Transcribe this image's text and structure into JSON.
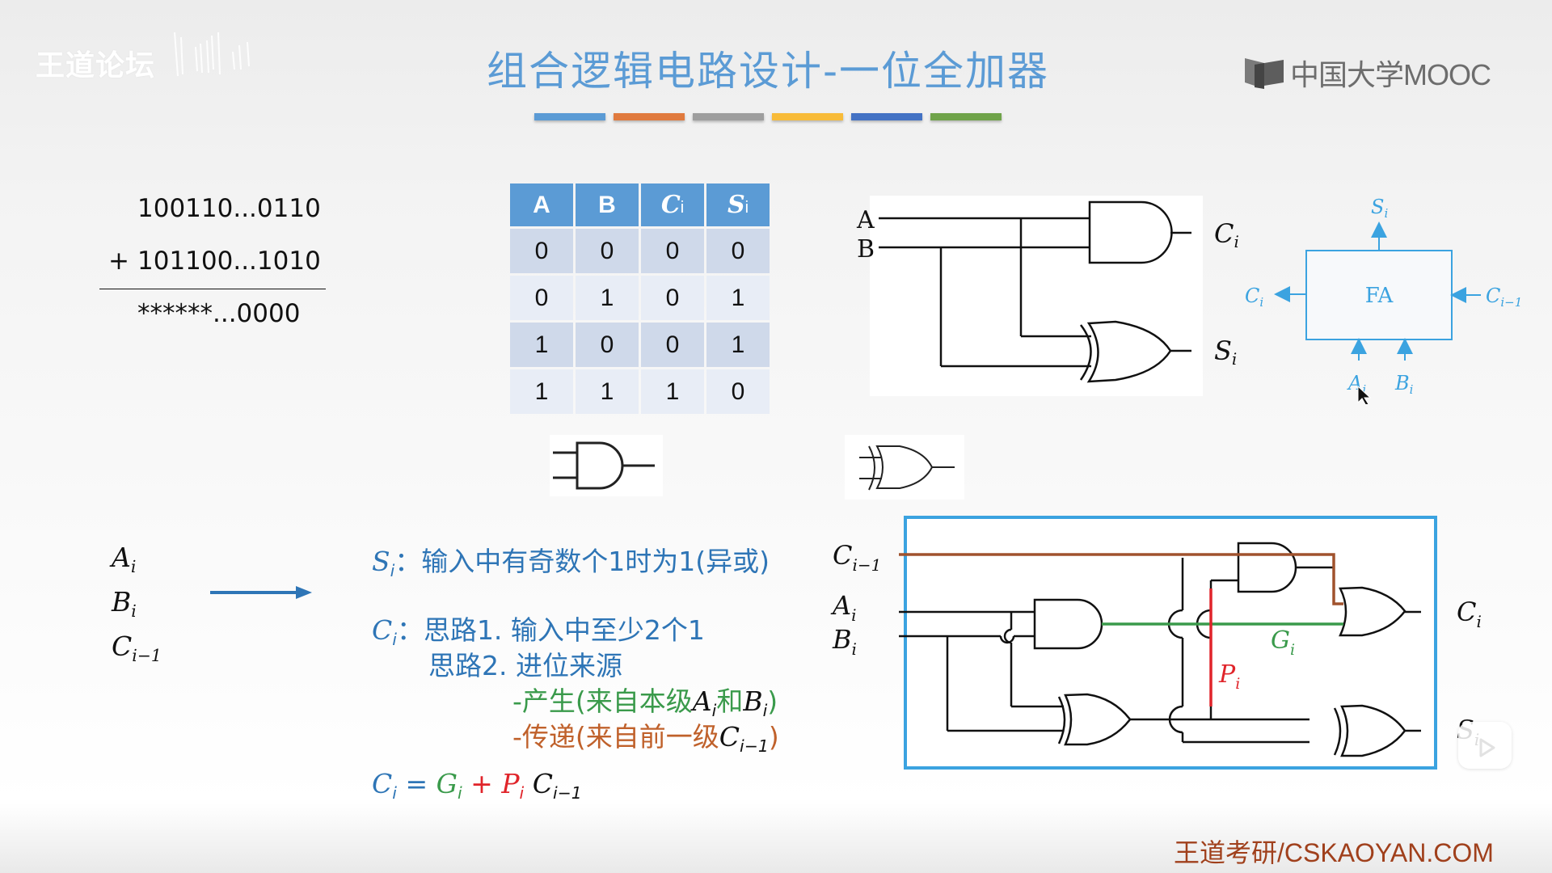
{
  "watermark": "王道论坛",
  "title": "组合逻辑电路设计-一位全加器",
  "title_bar_colors": [
    "#5b9bd5",
    "#e07a3e",
    "#9e9e9e",
    "#f8bb38",
    "#4372c4",
    "#6fa349"
  ],
  "brand": {
    "logo_text": "中国大学MOOC"
  },
  "addition": {
    "operand1": "100110...0110",
    "operator": "+",
    "operand2": "101100...1010",
    "result": "******...0000"
  },
  "truth_table": {
    "headers": [
      {
        "main": "A",
        "sub": ""
      },
      {
        "main": "B",
        "sub": ""
      },
      {
        "main": "C",
        "sub": "i"
      },
      {
        "main": "S",
        "sub": "i"
      }
    ],
    "rows": [
      [
        "0",
        "0",
        "0",
        "0"
      ],
      [
        "0",
        "1",
        "0",
        "1"
      ],
      [
        "1",
        "0",
        "0",
        "1"
      ],
      [
        "1",
        "1",
        "1",
        "0"
      ]
    ]
  },
  "half_adder": {
    "input_a": "A",
    "input_b": "B",
    "output_c": {
      "main": "C",
      "sub": "i"
    },
    "output_s": {
      "main": "S",
      "sub": "i"
    }
  },
  "fa_block": {
    "label": "FA",
    "top": {
      "main": "S",
      "sub": "i"
    },
    "left": {
      "main": "C",
      "sub": "i"
    },
    "right": {
      "main": "C",
      "sub": "i−1"
    },
    "bottom_a": {
      "main": "A",
      "sub": "i"
    },
    "bottom_b": {
      "main": "B",
      "sub": "i"
    },
    "color": "#3ba3e0"
  },
  "gate_samples": [
    "and-gate",
    "xor-gate"
  ],
  "inputs": [
    {
      "main": "A",
      "sub": "i"
    },
    {
      "main": "B",
      "sub": "i"
    },
    {
      "main": "C",
      "sub": "i−1"
    }
  ],
  "explanation": {
    "s_label": {
      "main": "S",
      "sub": "i"
    },
    "s_text": "：输入中有奇数个1时为1(异或)",
    "c_label": {
      "main": "C",
      "sub": "i"
    },
    "c_text1": "：思路1. 输入中至少2个1",
    "c_text2": "思路2. 进位来源",
    "generate_prefix": "-产生(来自本级",
    "generate_a": {
      "main": "A",
      "sub": "i"
    },
    "generate_mid": "和",
    "generate_b": {
      "main": "B",
      "sub": "i"
    },
    "generate_suffix": ")",
    "propagate_prefix": "-传递(来自前一级",
    "propagate_c": {
      "main": "C",
      "sub": "i−1"
    },
    "propagate_suffix": ")",
    "formula": {
      "lhs": {
        "main": "C",
        "sub": "i"
      },
      "eq": "=",
      "g": {
        "main": "G",
        "sub": "i"
      },
      "plus": "+",
      "p": {
        "main": "P",
        "sub": "i"
      },
      "c": {
        "main": "C",
        "sub": "i−1"
      }
    }
  },
  "full_adder_circuit": {
    "inputs": [
      {
        "main": "C",
        "sub": "i−1"
      },
      {
        "main": "A",
        "sub": "i"
      },
      {
        "main": "B",
        "sub": "i"
      }
    ],
    "outputs": [
      {
        "main": "C",
        "sub": "i"
      },
      {
        "main": "S",
        "sub": "i"
      }
    ],
    "g_label": {
      "main": "G",
      "sub": "i"
    },
    "p_label": {
      "main": "P",
      "sub": "i"
    },
    "colors": {
      "carry_in": "#a0522d",
      "generate": "#3a9a4b",
      "propagate": "#e0242a",
      "frame": "#3ba3e0"
    }
  },
  "footer": "王道考研/CSKAOYAN.COM"
}
